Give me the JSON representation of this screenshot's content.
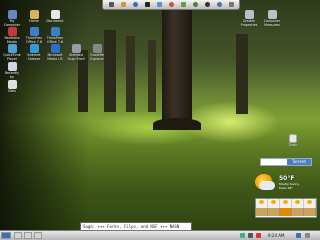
{
  "desktop_icons": [
    {
      "label": "My\nComputer",
      "icon": "computer-icon",
      "color": "#6a86c0"
    },
    {
      "label": "Home",
      "icon": "home-folder-icon",
      "color": "#d9b45c"
    },
    {
      "label": "Document",
      "icon": "document-icon",
      "color": "#e8e8e8"
    },
    {
      "label": "RedHatia\nMedia",
      "icon": "media-icon",
      "color": "#c03a3a"
    },
    {
      "label": "ThinkPrex\nOffice 7.6",
      "icon": "office-icon",
      "color": "#3b7ec6"
    },
    {
      "label": "ThinkPrex\nOffice 7.6",
      "icon": "office-icon",
      "color": "#3b7ec6"
    },
    {
      "label": "QuickTime\nPlayer",
      "icon": "quicktime-icon",
      "color": "#4aa0d8"
    },
    {
      "label": "Internet\nSidecke",
      "icon": "internet-icon",
      "color": "#3399dd"
    },
    {
      "label": "Microsoft\nMedia US",
      "icon": "windows-media-icon",
      "color": "#2c6fd1"
    },
    {
      "label": "Xtended\nScap Shell",
      "icon": "shell-icon",
      "color": "#99a"
    },
    {
      "label": "Goodlife\nExplorer",
      "icon": "explorer-icon",
      "color": "#888"
    },
    {
      "label": "Recently\nby",
      "icon": "recent-icon",
      "color": "#d0d6e0"
    },
    {
      "label": "Sites",
      "icon": "sites-icon",
      "color": "#e0e0e0"
    },
    {
      "label": "System\nProperties",
      "icon": "system-properties-icon",
      "color": "#b8c0cc"
    },
    {
      "label": "Computer\nMeasures",
      "icon": "computer-measures-icon",
      "color": "#b8c0cc"
    }
  ],
  "trash": {
    "label": "Trash",
    "icon": "trash-icon"
  },
  "topbar_icons": [
    "menu-icon",
    "folder-icon",
    "browser-icon",
    "terminal-icon",
    "mail-icon",
    "music-icon",
    "photo-icon",
    "chat-icon",
    "settings-icon",
    "help-icon",
    "power-icon"
  ],
  "search": {
    "button_label": "Torrent"
  },
  "weather": {
    "temp": "50°F",
    "detail": "Mostly Sunny\nFeels 48°"
  },
  "ticker": {
    "text": "Saga: +++ Forks, Filps, and NSF +++ NASN"
  },
  "clock": {
    "text": "9:24 AM"
  }
}
